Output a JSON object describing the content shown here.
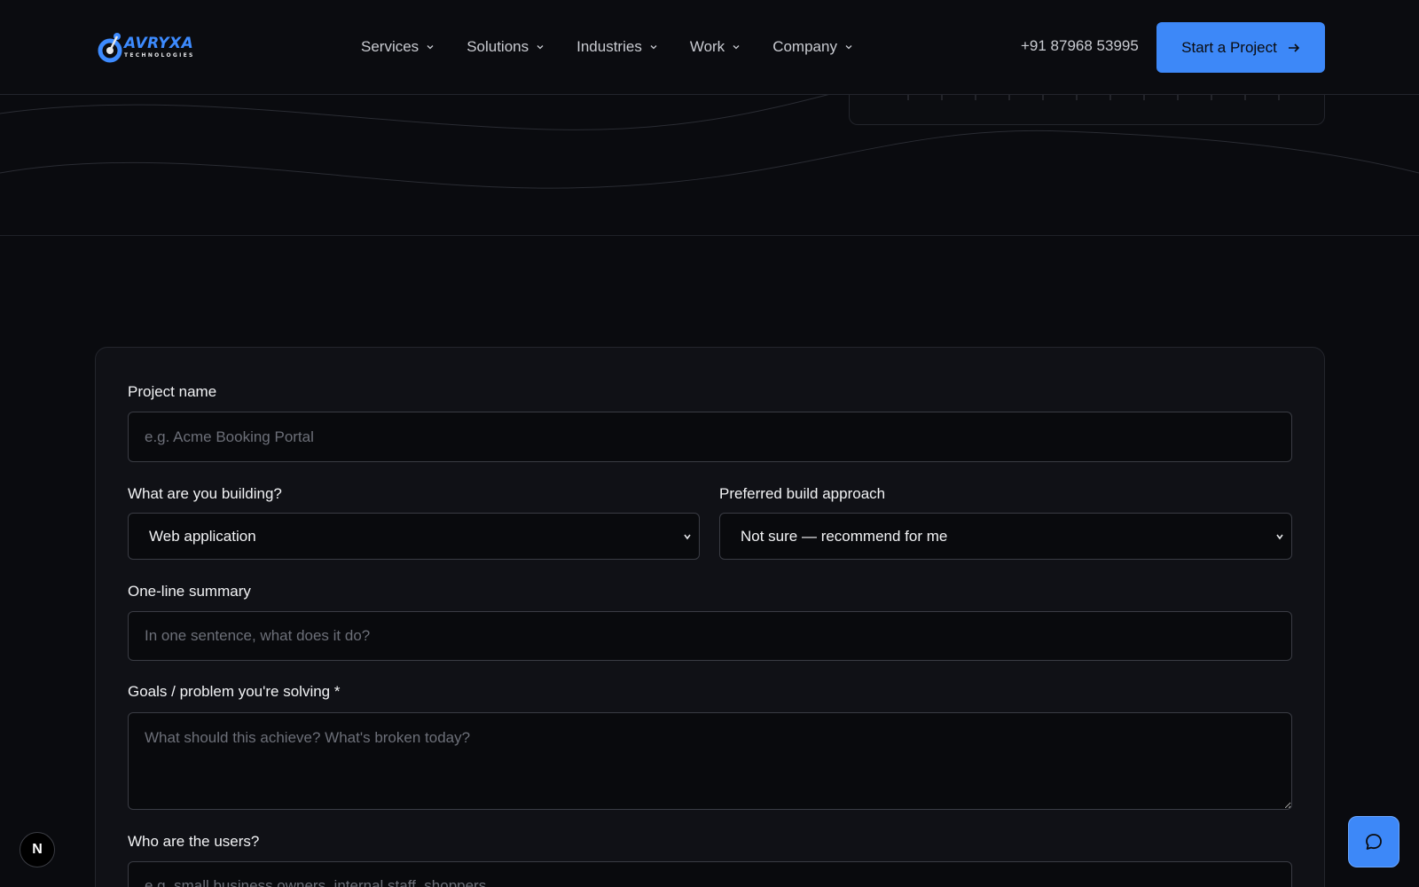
{
  "header": {
    "logo": {
      "word": "AVRYXA",
      "sub": "TECHNOLOGIES"
    },
    "nav": [
      {
        "label": "Services"
      },
      {
        "label": "Solutions"
      },
      {
        "label": "Industries"
      },
      {
        "label": "Work"
      },
      {
        "label": "Company"
      }
    ],
    "phone": "+91 87968 53995",
    "cta_label": "Start a Project"
  },
  "form": {
    "project_name": {
      "label": "Project name",
      "placeholder": "e.g. Acme Booking Portal"
    },
    "building": {
      "label": "What are you building?",
      "value": "Web application"
    },
    "approach": {
      "label": "Preferred build approach",
      "value": "Not sure — recommend for me"
    },
    "summary": {
      "label": "One-line summary",
      "placeholder": "In one sentence, what does it do?"
    },
    "goals": {
      "label": "Goals / problem you're solving *",
      "placeholder": "What should this achieve? What's broken today?"
    },
    "users": {
      "label": "Who are the users?",
      "placeholder": "e.g. small business owners, internal staff, shoppers"
    }
  },
  "floating": {
    "n_badge": "N"
  },
  "colors": {
    "accent": "#3d88f8",
    "background": "#0a0b0f",
    "card": "#101116"
  }
}
